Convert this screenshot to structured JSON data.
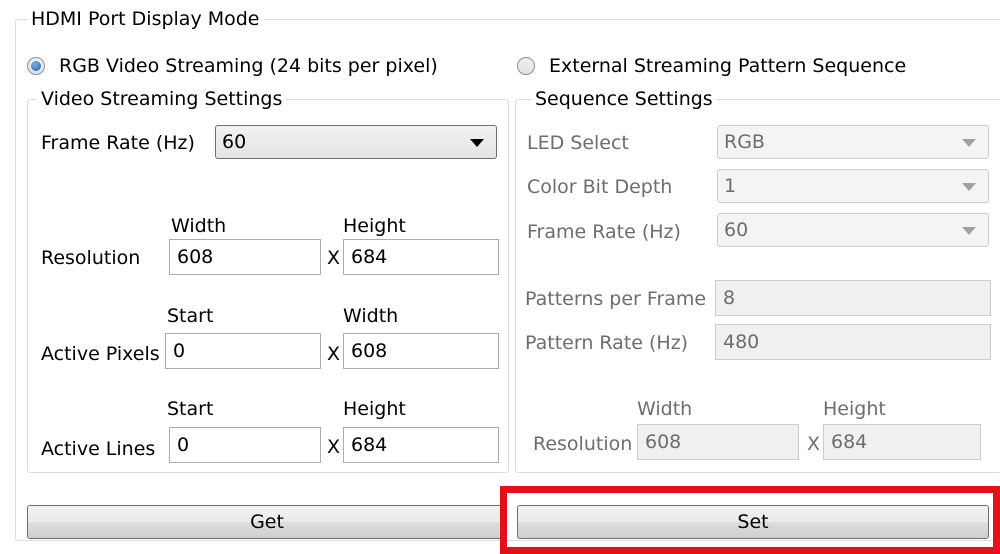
{
  "display_mode": {
    "title": "HDMI Port Display Mode",
    "option_rgb": "RGB Video Streaming (24 bits per pixel)",
    "option_external": "External Streaming Pattern Sequence"
  },
  "video_settings": {
    "title": "Video Streaming Settings",
    "frame_rate_label": "Frame Rate (Hz)",
    "frame_rate_value": "60",
    "resolution_label": "Resolution",
    "resolution_width_header": "Width",
    "resolution_height_header": "Height",
    "resolution_width": "608",
    "resolution_height": "684",
    "active_pixels_label": "Active Pixels",
    "active_pixels_start_header": "Start",
    "active_pixels_width_header": "Width",
    "active_pixels_start": "0",
    "active_pixels_width": "608",
    "active_lines_label": "Active Lines",
    "active_lines_start_header": "Start",
    "active_lines_height_header": "Height",
    "active_lines_start": "0",
    "active_lines_height": "684",
    "x_sep": "X"
  },
  "sequence_settings": {
    "title": "Sequence Settings",
    "led_select_label": "LED Select",
    "led_select_value": "RGB",
    "color_bit_depth_label": "Color Bit Depth",
    "color_bit_depth_value": "1",
    "frame_rate_label": "Frame Rate (Hz)",
    "frame_rate_value": "60",
    "patterns_per_frame_label": "Patterns per Frame",
    "patterns_per_frame_value": "8",
    "pattern_rate_label": "Pattern Rate (Hz)",
    "pattern_rate_value": "480",
    "resolution_label": "Resolution",
    "resolution_width_header": "Width",
    "resolution_height_header": "Height",
    "resolution_width": "608",
    "resolution_height": "684",
    "x_sep": "X"
  },
  "buttons": {
    "get_label": "Get",
    "set_label": "Set"
  },
  "colors": {
    "highlight": "#e3101b",
    "border": "#d5dfe5"
  }
}
